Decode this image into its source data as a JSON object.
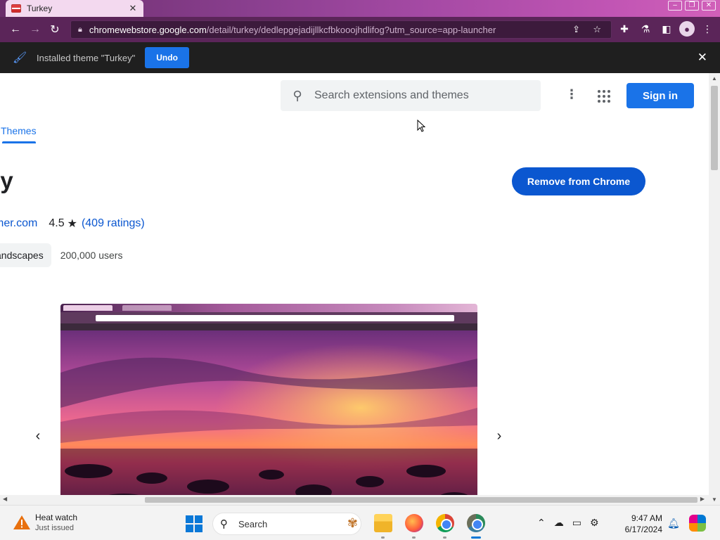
{
  "browser": {
    "tab_title": "Turkey",
    "tab_close": "✕",
    "url_host": "chromewebstore.google.com",
    "url_path": "/detail/turkey/dedlepgejadijllkcfbkooojhdlifog?utm_source=app-launcher"
  },
  "infobar": {
    "message": "Installed theme \"Turkey\"",
    "undo_label": "Undo",
    "close_glyph": "✕"
  },
  "store": {
    "search_placeholder": "Search extensions and themes",
    "signin_label": "Sign in",
    "themes_tab": "Themes",
    "item_title_visible": "ey",
    "remove_label": "Remove from Chrome",
    "offered_by_visible": "mer.com",
    "rating_value": "4.5",
    "rating_star": "★",
    "ratings_link": "(409 ratings)",
    "category_chip": "andscapes",
    "users": "200,000 users",
    "carousel_prev": "‹",
    "carousel_next": "›"
  },
  "taskbar": {
    "weather_title": "Heat watch",
    "weather_sub": "Just issued",
    "search_label": "Search",
    "time": "9:47 AM",
    "date": "6/17/2024"
  },
  "colors": {
    "theme_frame": "#5b2559",
    "accent": "#1a73e8",
    "remove_button": "#0b57d0"
  },
  "icons": [
    "tab-favicon-icon",
    "back-arrow-icon",
    "forward-arrow-icon",
    "reload-icon",
    "lock-icon",
    "share-icon",
    "bookmark-star-icon",
    "extensions-puzzle-icon",
    "lab-flask-icon",
    "side-panel-icon",
    "profile-avatar-icon",
    "browser-menu-icon",
    "paintbrush-icon",
    "search-icon",
    "more-vert-icon",
    "apps-grid-icon",
    "windows-start-icon",
    "warning-icon"
  ]
}
